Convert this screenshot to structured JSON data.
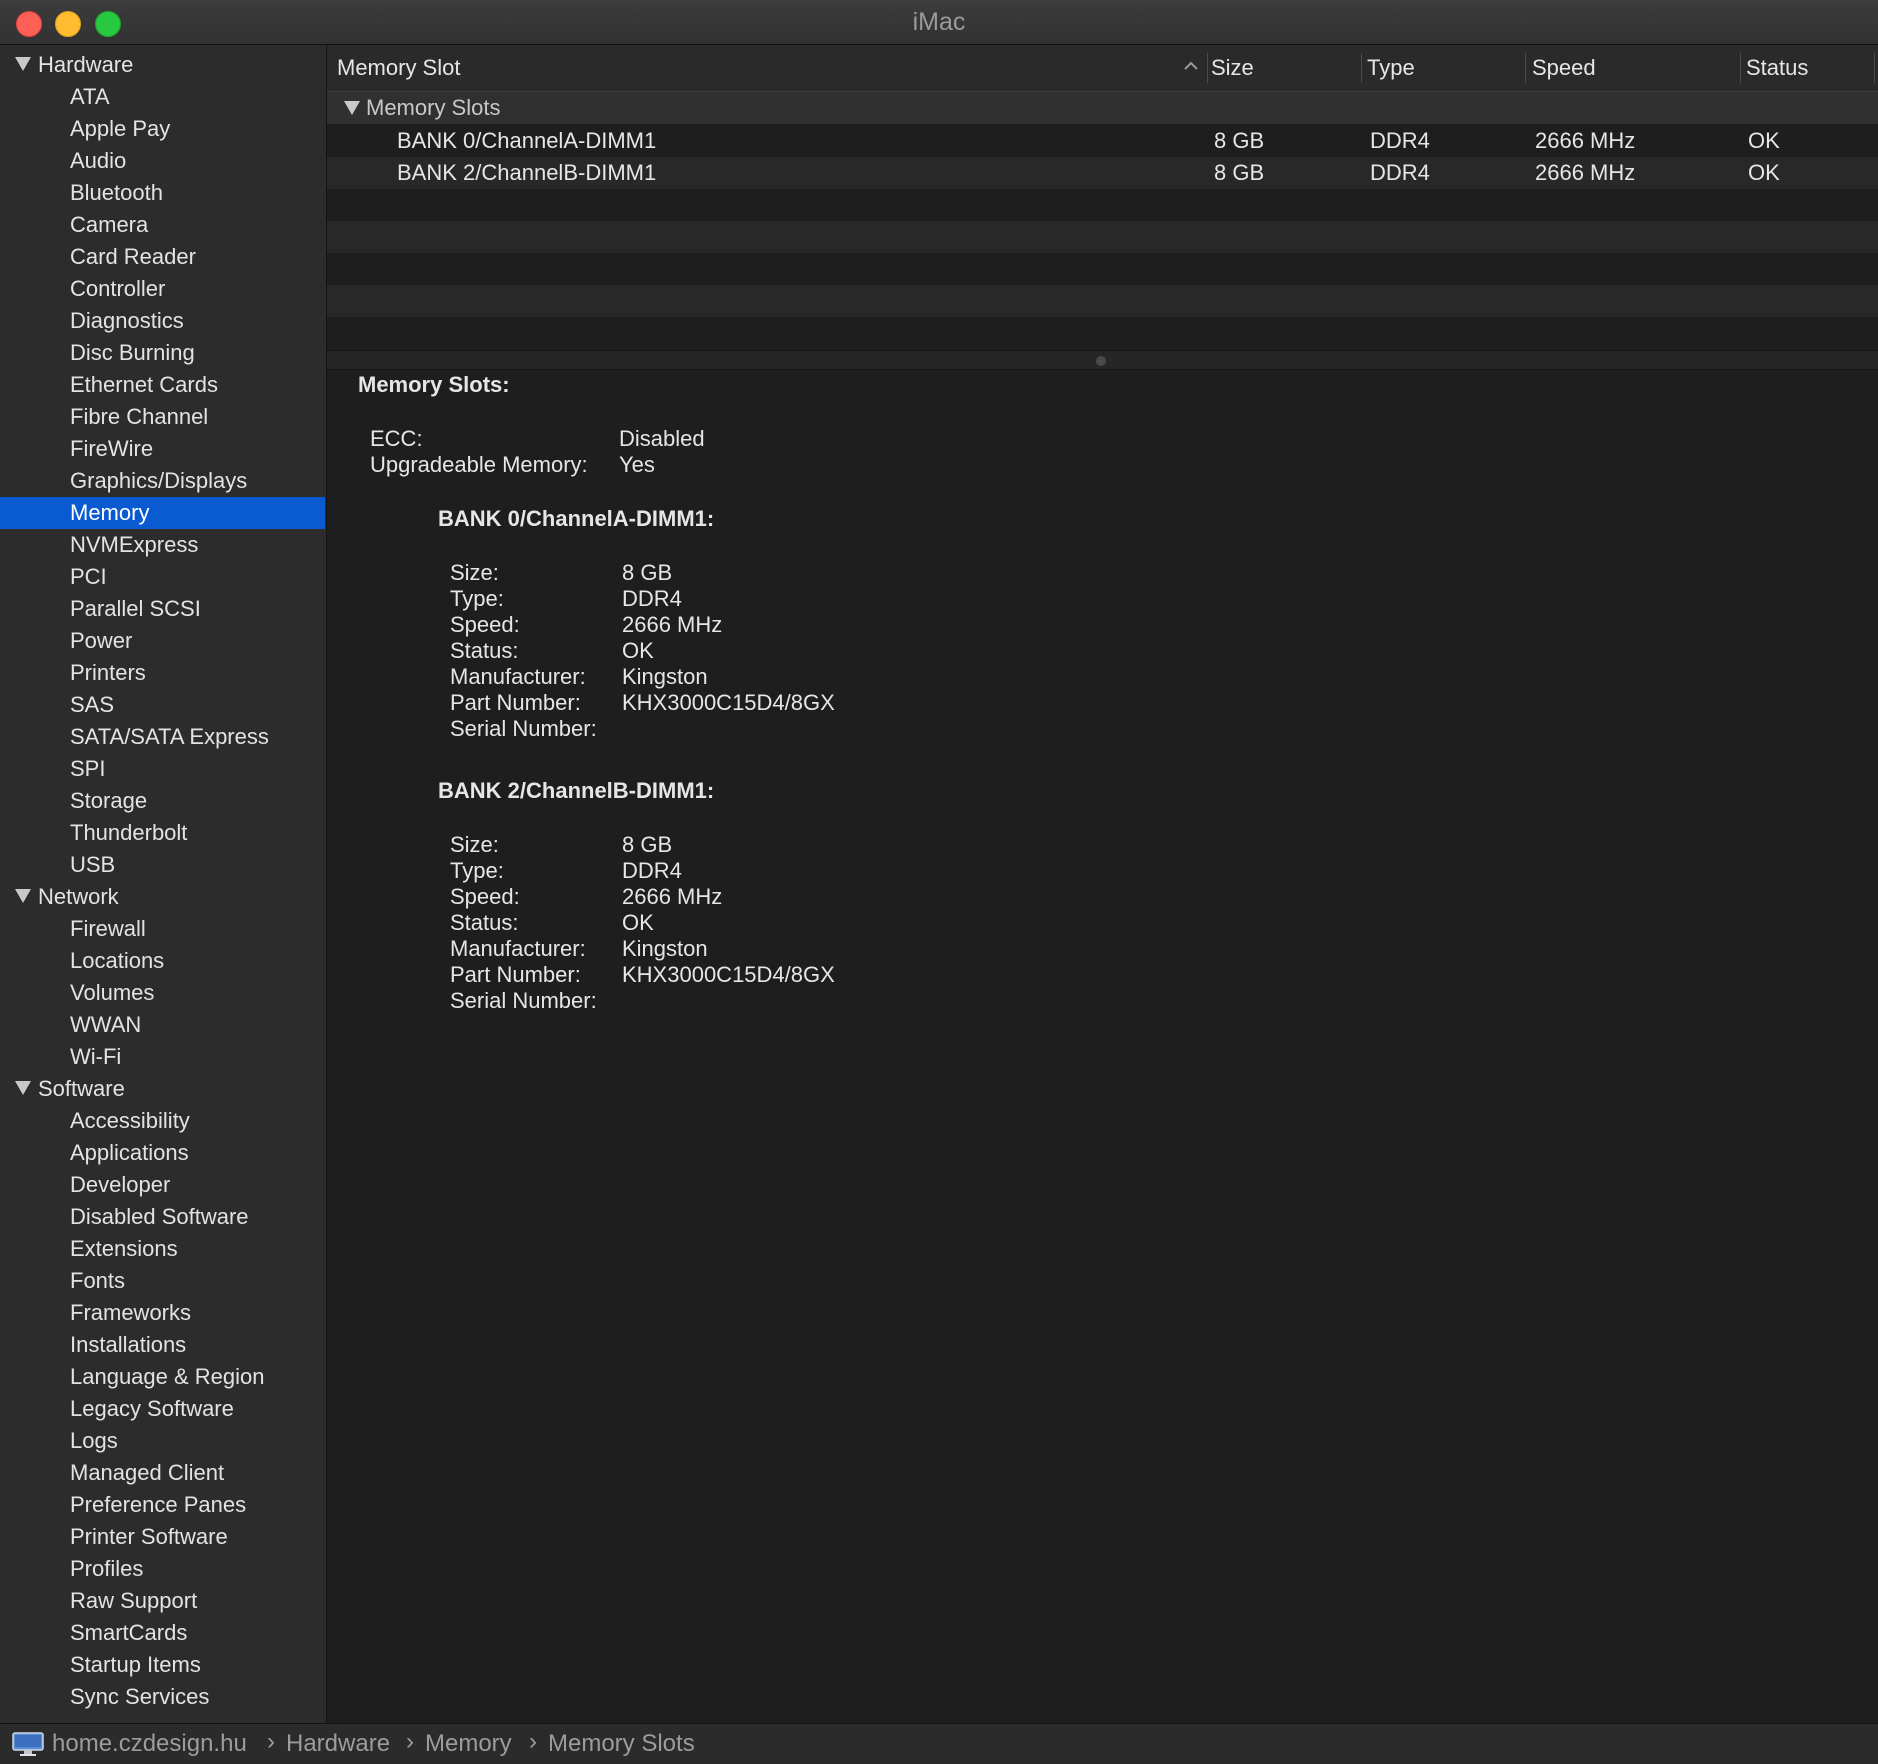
{
  "window": {
    "title": "iMac"
  },
  "sidebar": {
    "groups": [
      {
        "label": "Hardware",
        "items": [
          "ATA",
          "Apple Pay",
          "Audio",
          "Bluetooth",
          "Camera",
          "Card Reader",
          "Controller",
          "Diagnostics",
          "Disc Burning",
          "Ethernet Cards",
          "Fibre Channel",
          "FireWire",
          "Graphics/Displays",
          "Memory",
          "NVMExpress",
          "PCI",
          "Parallel SCSI",
          "Power",
          "Printers",
          "SAS",
          "SATA/SATA Express",
          "SPI",
          "Storage",
          "Thunderbolt",
          "USB"
        ]
      },
      {
        "label": "Network",
        "items": [
          "Firewall",
          "Locations",
          "Volumes",
          "WWAN",
          "Wi-Fi"
        ]
      },
      {
        "label": "Software",
        "items": [
          "Accessibility",
          "Applications",
          "Developer",
          "Disabled Software",
          "Extensions",
          "Fonts",
          "Frameworks",
          "Installations",
          "Language & Region",
          "Legacy Software",
          "Logs",
          "Managed Client",
          "Preference Panes",
          "Printer Software",
          "Profiles",
          "Raw Support",
          "SmartCards",
          "Startup Items",
          "Sync Services"
        ]
      }
    ],
    "selected": "Memory"
  },
  "table": {
    "columns": [
      "Memory Slot",
      "Size",
      "Type",
      "Speed",
      "Status"
    ],
    "group_label": "Memory Slots",
    "rows": [
      [
        "BANK 0/ChannelA-DIMM1",
        "8 GB",
        "DDR4",
        "2666 MHz",
        "OK"
      ],
      [
        "BANK 2/ChannelB-DIMM1",
        "8 GB",
        "DDR4",
        "2666 MHz",
        "OK"
      ]
    ]
  },
  "detail": {
    "heading": "Memory Slots:",
    "summary": [
      {
        "key": "ECC:",
        "value": "Disabled"
      },
      {
        "key": "Upgradeable Memory:",
        "value": "Yes"
      }
    ],
    "banks": [
      {
        "title": "BANK 0/ChannelA-DIMM1:",
        "fields": [
          {
            "key": "Size:",
            "value": "8 GB"
          },
          {
            "key": "Type:",
            "value": "DDR4"
          },
          {
            "key": "Speed:",
            "value": "2666 MHz"
          },
          {
            "key": "Status:",
            "value": "OK"
          },
          {
            "key": "Manufacturer:",
            "value": "Kingston"
          },
          {
            "key": "Part Number:",
            "value": "KHX3000C15D4/8GX"
          },
          {
            "key": "Serial Number:",
            "value": ""
          }
        ]
      },
      {
        "title": "BANK 2/ChannelB-DIMM1:",
        "fields": [
          {
            "key": "Size:",
            "value": "8 GB"
          },
          {
            "key": "Type:",
            "value": "DDR4"
          },
          {
            "key": "Speed:",
            "value": "2666 MHz"
          },
          {
            "key": "Status:",
            "value": "OK"
          },
          {
            "key": "Manufacturer:",
            "value": "Kingston"
          },
          {
            "key": "Part Number:",
            "value": "KHX3000C15D4/8GX"
          },
          {
            "key": "Serial Number:",
            "value": ""
          }
        ]
      }
    ]
  },
  "statusbar": {
    "icon": "imac-icon",
    "breadcrumb": [
      "home.czdesign.hu",
      "Hardware",
      "Memory",
      "Memory Slots"
    ],
    "separator": "›"
  },
  "colors": {
    "selection": "#0a5ad2",
    "close": "#fe5f57",
    "minimize": "#febc2e",
    "maximize": "#28c840"
  }
}
